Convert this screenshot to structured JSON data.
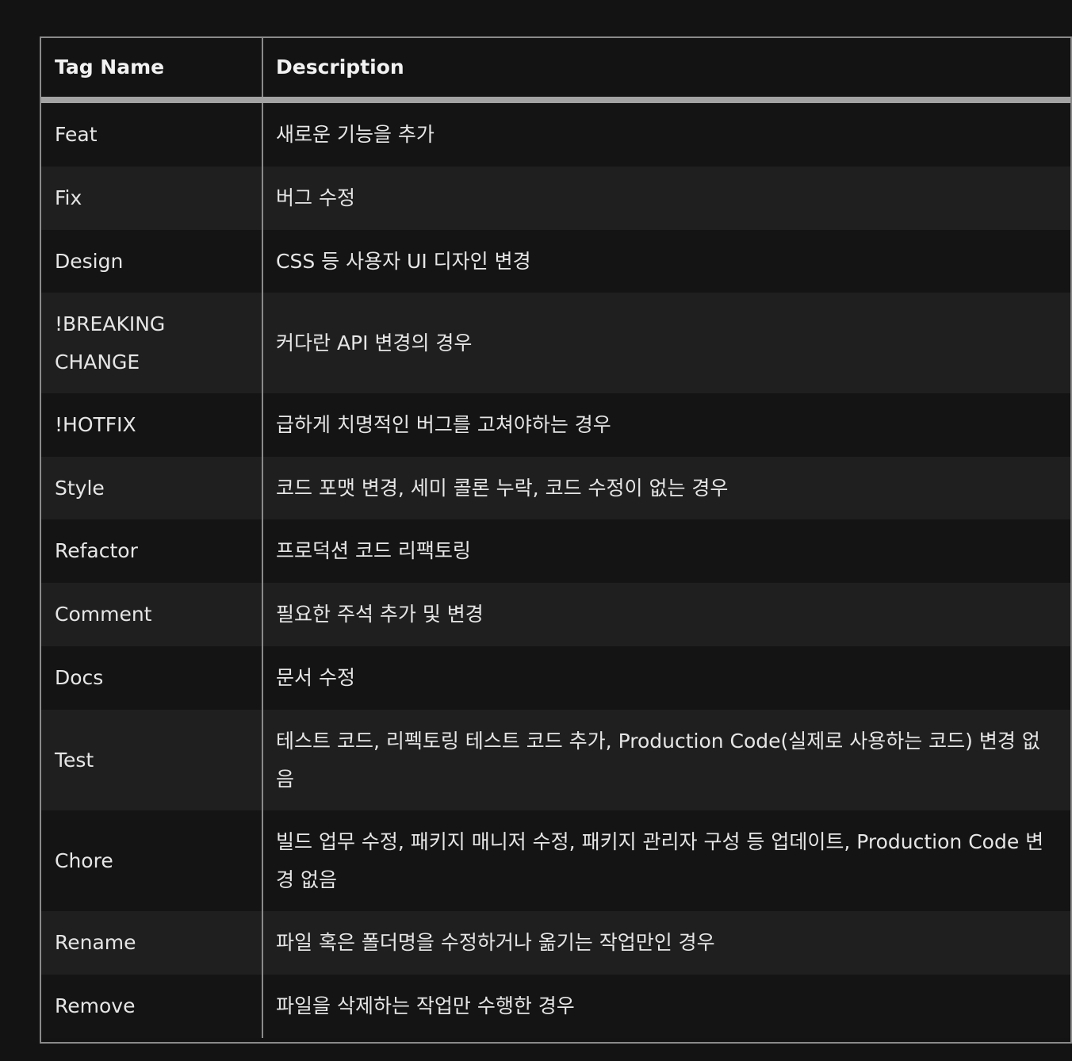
{
  "table": {
    "headers": [
      "Tag Name",
      "Description"
    ],
    "rows": [
      {
        "tag": "Feat",
        "desc": "새로운 기능을 추가"
      },
      {
        "tag": "Fix",
        "desc": "버그 수정"
      },
      {
        "tag": "Design",
        "desc": "CSS 등 사용자 UI 디자인 변경"
      },
      {
        "tag": "!BREAKING CHANGE",
        "desc": "커다란 API 변경의 경우"
      },
      {
        "tag": "!HOTFIX",
        "desc": "급하게 치명적인 버그를 고쳐야하는 경우"
      },
      {
        "tag": "Style",
        "desc": "코드 포맷 변경, 세미 콜론 누락, 코드 수정이 없는 경우"
      },
      {
        "tag": "Refactor",
        "desc": "프로덕션 코드 리팩토링"
      },
      {
        "tag": "Comment",
        "desc": "필요한 주석 추가 및 변경"
      },
      {
        "tag": "Docs",
        "desc": "문서 수정"
      },
      {
        "tag": "Test",
        "desc": "테스트 코드, 리펙토링 테스트 코드 추가, Production Code(실제로 사용하는 코드) 변경 없음"
      },
      {
        "tag": "Chore",
        "desc": "빌드 업무 수정, 패키지 매니저 수정, 패키지 관리자 구성 등 업데이트, Production Code 변경 없음"
      },
      {
        "tag": "Rename",
        "desc": "파일 혹은 폴더명을 수정하거나 옮기는 작업만인 경우"
      },
      {
        "tag": "Remove",
        "desc": "파일을 삭제하는 작업만 수행한 경우"
      }
    ]
  }
}
